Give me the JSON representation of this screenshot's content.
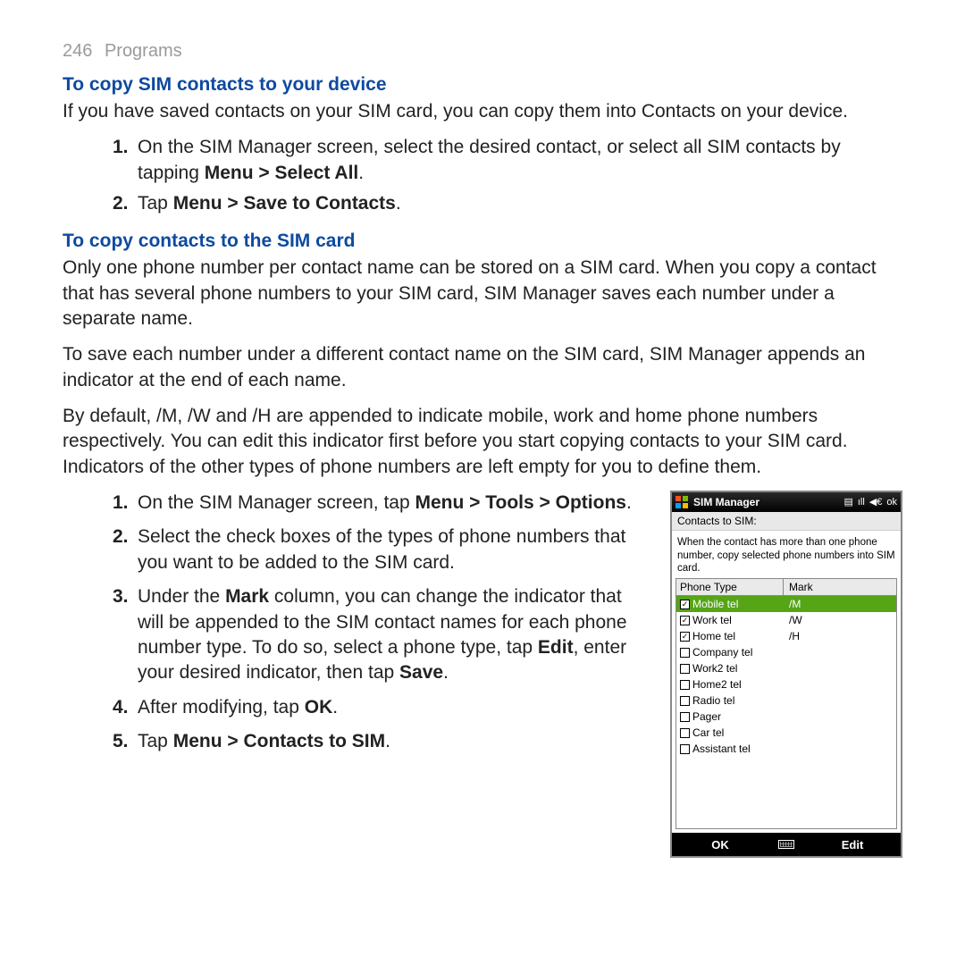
{
  "header": {
    "page_number": "246",
    "chapter": "Programs"
  },
  "section_a": {
    "title": "To copy SIM contacts to your device",
    "intro": "If you have saved contacts on your SIM card, you can copy them into Contacts on your device.",
    "steps": [
      {
        "num": "1.",
        "parts": [
          "On the SIM Manager screen, select the desired contact, or select all SIM contacts by tapping ",
          "Menu > Select All",
          "."
        ]
      },
      {
        "num": "2.",
        "parts_pre": "Tap ",
        "bold_all": "Menu > Save to Contacts",
        "parts_post": "."
      }
    ]
  },
  "section_b": {
    "title": "To copy contacts to the SIM card",
    "paragraphs": [
      "Only one phone number per contact name can be stored on a SIM card. When you copy a contact that has several phone numbers to your SIM card, SIM Manager saves each number under a separate name.",
      "To save each number under a different contact name on the SIM card, SIM Manager appends an indicator at the end of each name.",
      "By default, /M, /W and /H are appended to indicate mobile, work and home phone numbers respectively. You can edit this indicator first before you start copying contacts to your SIM card. Indicators of the other types of phone numbers are left empty for you to define them."
    ],
    "steps": [
      {
        "num": "1.",
        "segments": [
          {
            "t": "On the SIM Manager screen, tap "
          },
          {
            "t": "Menu > Tools > Options",
            "b": true
          },
          {
            "t": "."
          }
        ]
      },
      {
        "num": "2.",
        "segments": [
          {
            "t": "Select the check boxes of the types of phone numbers that you want to be added to the SIM card."
          }
        ]
      },
      {
        "num": "3.",
        "segments": [
          {
            "t": "Under the "
          },
          {
            "t": "Mark",
            "b": true
          },
          {
            "t": " column, you can change the indicator that will be appended to the SIM contact names for each phone number type. To do so, select a phone type, tap "
          },
          {
            "t": "Edit",
            "b": true
          },
          {
            "t": ", enter your desired indicator, then tap "
          },
          {
            "t": "Save",
            "b": true
          },
          {
            "t": "."
          }
        ]
      },
      {
        "num": "4.",
        "segments": [
          {
            "t": "After modifying, tap "
          },
          {
            "t": "OK",
            "b": true
          },
          {
            "t": "."
          }
        ]
      },
      {
        "num": "5.",
        "segments": [
          {
            "t": "Tap "
          },
          {
            "t": "Menu > Contacts to SIM",
            "b": true
          },
          {
            "t": "."
          }
        ],
        "num_bold": true
      }
    ]
  },
  "phone": {
    "title": "SIM Manager",
    "status_icons": {
      "sd": "⎙",
      "signal": "▮▮▯",
      "volume": "◀",
      "ok": "ok"
    },
    "subheader": "Contacts to SIM:",
    "description": "When the contact has more than one phone number, copy selected phone numbers into SIM card.",
    "columns": {
      "c1": "Phone Type",
      "c2": "Mark"
    },
    "rows": [
      {
        "checked": true,
        "label": "Mobile tel",
        "mark": "/M",
        "selected": true
      },
      {
        "checked": true,
        "label": "Work tel",
        "mark": "/W"
      },
      {
        "checked": true,
        "label": "Home tel",
        "mark": "/H"
      },
      {
        "checked": false,
        "label": "Company tel",
        "mark": ""
      },
      {
        "checked": false,
        "label": "Work2 tel",
        "mark": ""
      },
      {
        "checked": false,
        "label": "Home2 tel",
        "mark": ""
      },
      {
        "checked": false,
        "label": "Radio tel",
        "mark": ""
      },
      {
        "checked": false,
        "label": "Pager",
        "mark": ""
      },
      {
        "checked": false,
        "label": "Car tel",
        "mark": ""
      },
      {
        "checked": false,
        "label": "Assistant tel",
        "mark": ""
      }
    ],
    "menubar": {
      "left": "OK",
      "right": "Edit"
    }
  }
}
